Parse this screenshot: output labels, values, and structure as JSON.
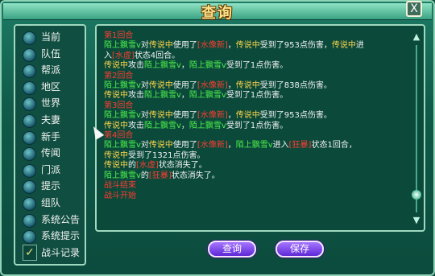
{
  "window": {
    "title": "查询",
    "close_label": "X"
  },
  "sidebar": {
    "items": [
      {
        "label": "当前",
        "checked": false
      },
      {
        "label": "队伍",
        "checked": false
      },
      {
        "label": "帮派",
        "checked": false
      },
      {
        "label": "地区",
        "checked": false
      },
      {
        "label": "世界",
        "checked": false
      },
      {
        "label": "夫妻",
        "checked": false
      },
      {
        "label": "新手",
        "checked": false
      },
      {
        "label": "传闻",
        "checked": false
      },
      {
        "label": "门派",
        "checked": false
      },
      {
        "label": "提示",
        "checked": false
      },
      {
        "label": "组队",
        "checked": false
      },
      {
        "label": "系统公告",
        "checked": false
      },
      {
        "label": "系统提示",
        "checked": false
      },
      {
        "label": "战斗记录",
        "checked": true
      }
    ]
  },
  "log": {
    "lines": [
      [
        {
          "t": "第1回合",
          "c": "r"
        }
      ],
      [
        {
          "t": "陌上飘雪ⅴ",
          "c": "g"
        },
        {
          "t": "对",
          "c": "w"
        },
        {
          "t": "传说中",
          "c": "y"
        },
        {
          "t": "使用了",
          "c": "w"
        },
        {
          "t": "[水像新]",
          "c": "r"
        },
        {
          "t": "，",
          "c": "w"
        },
        {
          "t": "传说中",
          "c": "y"
        },
        {
          "t": "受到了953点伤害，",
          "c": "w"
        },
        {
          "t": "传说中",
          "c": "y"
        },
        {
          "t": "进",
          "c": "w"
        }
      ],
      [
        {
          "t": "入",
          "c": "w"
        },
        {
          "t": "[水虚]",
          "c": "r"
        },
        {
          "t": "状态4回合。",
          "c": "w"
        }
      ],
      [
        {
          "t": "传说中",
          "c": "y"
        },
        {
          "t": "攻击",
          "c": "w"
        },
        {
          "t": "陌上飘雪ⅴ",
          "c": "g"
        },
        {
          "t": "，",
          "c": "w"
        },
        {
          "t": "陌上飘雪ⅴ",
          "c": "g"
        },
        {
          "t": "受到了1点伤害。",
          "c": "w"
        }
      ],
      [
        {
          "t": "第2回合",
          "c": "r"
        }
      ],
      [
        {
          "t": "陌上飘雪ⅴ",
          "c": "g"
        },
        {
          "t": "对",
          "c": "w"
        },
        {
          "t": "传说中",
          "c": "y"
        },
        {
          "t": "使用了",
          "c": "w"
        },
        {
          "t": "[水像新]",
          "c": "r"
        },
        {
          "t": "，",
          "c": "w"
        },
        {
          "t": "传说中",
          "c": "y"
        },
        {
          "t": "受到了838点伤害。",
          "c": "w"
        }
      ],
      [
        {
          "t": "传说中",
          "c": "y"
        },
        {
          "t": "攻击",
          "c": "w"
        },
        {
          "t": "陌上飘雪ⅴ",
          "c": "g"
        },
        {
          "t": "，",
          "c": "w"
        },
        {
          "t": "陌上飘雪ⅴ",
          "c": "g"
        },
        {
          "t": "受到了1点伤害。",
          "c": "w"
        }
      ],
      [
        {
          "t": "第3回合",
          "c": "r"
        }
      ],
      [
        {
          "t": "陌上飘雪ⅴ",
          "c": "g"
        },
        {
          "t": "对",
          "c": "w"
        },
        {
          "t": "传说中",
          "c": "y"
        },
        {
          "t": "使用了",
          "c": "w"
        },
        {
          "t": "[水像新]",
          "c": "r"
        },
        {
          "t": "，",
          "c": "w"
        },
        {
          "t": "传说中",
          "c": "y"
        },
        {
          "t": "受到了953点伤害。",
          "c": "w"
        }
      ],
      [
        {
          "t": "传说中",
          "c": "y"
        },
        {
          "t": "攻击",
          "c": "w"
        },
        {
          "t": "陌上飘雪ⅴ",
          "c": "g"
        },
        {
          "t": "，",
          "c": "w"
        },
        {
          "t": "陌上飘雪ⅴ",
          "c": "g"
        },
        {
          "t": "受到了1点伤害。",
          "c": "w"
        }
      ],
      [
        {
          "t": "第4回合",
          "c": "r"
        }
      ],
      [
        {
          "t": "陌上飘雪ⅴ",
          "c": "g"
        },
        {
          "t": "对",
          "c": "w"
        },
        {
          "t": "传说中",
          "c": "y"
        },
        {
          "t": "使用了",
          "c": "w"
        },
        {
          "t": "[水像新]",
          "c": "r"
        },
        {
          "t": "，",
          "c": "w"
        },
        {
          "t": "陌上飘雪ⅴ",
          "c": "g"
        },
        {
          "t": "进入",
          "c": "w"
        },
        {
          "t": "[狂暴]",
          "c": "r"
        },
        {
          "t": "状态1回合，",
          "c": "w"
        }
      ],
      [
        {
          "t": "传说中",
          "c": "y"
        },
        {
          "t": "受到了1321点伤害。",
          "c": "w"
        }
      ],
      [
        {
          "t": "传说中",
          "c": "y"
        },
        {
          "t": "的",
          "c": "w"
        },
        {
          "t": "[水虚]",
          "c": "r"
        },
        {
          "t": "状态消失了。",
          "c": "w"
        }
      ],
      [
        {
          "t": "陌上飘雪ⅴ",
          "c": "g"
        },
        {
          "t": "的",
          "c": "w"
        },
        {
          "t": "[狂暴]",
          "c": "r"
        },
        {
          "t": "状态消失了。",
          "c": "w"
        }
      ],
      [
        {
          "t": "战斗结束",
          "c": "r"
        }
      ],
      [
        {
          "t": "战斗开始",
          "c": "r"
        }
      ]
    ]
  },
  "buttons": {
    "query": "查询",
    "save": "保存"
  },
  "colors": {
    "red": "#ff3b2f",
    "yellow": "#ffd54a",
    "green": "#4df04a",
    "white": "#f2f2f2"
  }
}
